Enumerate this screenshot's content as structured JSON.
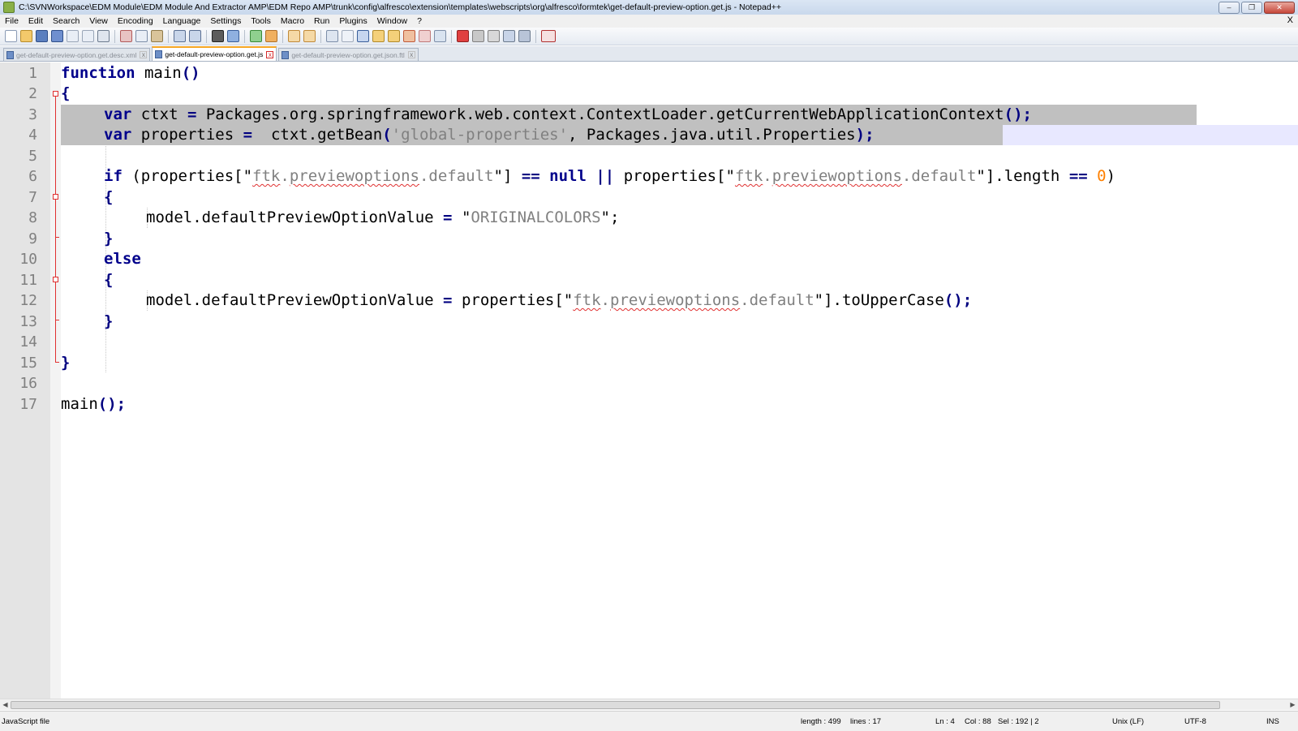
{
  "window": {
    "title": "C:\\SVNWorkspace\\EDM Module\\EDM Module And Extractor AMP\\EDM Repo AMP\\trunk\\config\\alfresco\\extension\\templates\\webscripts\\org\\alfresco\\formtek\\get-default-preview-option.get.js - Notepad++",
    "minimize": "–",
    "restore": "❐",
    "close": "✕"
  },
  "menu": {
    "items": [
      "File",
      "Edit",
      "Search",
      "View",
      "Encoding",
      "Language",
      "Settings",
      "Tools",
      "Macro",
      "Run",
      "Plugins",
      "Window",
      "?"
    ],
    "close": "X"
  },
  "tabs": [
    {
      "label": "get-default-preview-option.get.desc.xml",
      "active": false
    },
    {
      "label": "get-default-preview-option.get.js",
      "active": true
    },
    {
      "label": "get-default-preview-option.get.json.ftl",
      "active": false
    }
  ],
  "tab_close_glyph": "x",
  "editor": {
    "line_numbers": [
      "1",
      "2",
      "3",
      "4",
      "5",
      "6",
      "7",
      "8",
      "9",
      "10",
      "11",
      "12",
      "13",
      "14",
      "15",
      "16",
      "17"
    ],
    "code": {
      "l1_kw": "function",
      "l1_rest": " main",
      "l1_paren": "()",
      "l2": "{",
      "l3_kw": "var",
      "l3_a": " ctxt ",
      "l3_eq": "=",
      "l3_b": " Packages.org.springframework.web.context.ContextLoader.getCurrentWebApplicationContext",
      "l3_end": "();",
      "l4_kw": "var",
      "l4_a": " properties ",
      "l4_eq": "=",
      "l4_b": "  ctxt.getBean",
      "l4_p1": "(",
      "l4_str": "'global-properties'",
      "l4_c": ", Packages.java.util.Properties",
      "l4_end": ");",
      "l6_kw": "if",
      "l6_a": " (properties[\"",
      "l6_s1": "ftk",
      "l6_s2": ".",
      "l6_s3": "previewoptions",
      "l6_s4": ".default",
      "l6_b": "\"] ",
      "l6_op1": "==",
      "l6_null": " null ",
      "l6_or": "||",
      "l6_c": " properties[\"",
      "l6_d": "\"].length ",
      "l6_op2": "==",
      "l6_zero": "0",
      "l6_close": ")",
      "l7": "{",
      "l8_a": "model.defaultPreviewOptionValue ",
      "l8_eq": "=",
      "l8_b": " \"",
      "l8_str": "ORIGINALCOLORS",
      "l8_c": "\";",
      "l9": "}",
      "l10_kw": "else",
      "l11": "{",
      "l12_a": "model.defaultPreviewOptionValue ",
      "l12_eq": "=",
      "l12_b": " properties[\"",
      "l12_c": "\"].toUpperCase",
      "l12_end": "();",
      "l13": "}",
      "l15": "}",
      "l17_a": "main",
      "l17_end": "();"
    }
  },
  "status": {
    "file_type": "JavaScript file",
    "length": "length : 499",
    "lines": "lines : 17",
    "ln": "Ln : 4",
    "col": "Col : 88",
    "sel": "Sel : 192 | 2",
    "eol": "Unix (LF)",
    "encoding": "UTF-8",
    "mode": "INS"
  },
  "colors": {
    "keyword": "#00008b",
    "string": "#808080",
    "number": "#ff8000",
    "selection": "#c0c0c0",
    "active_tab_accent": "#f5a623"
  }
}
